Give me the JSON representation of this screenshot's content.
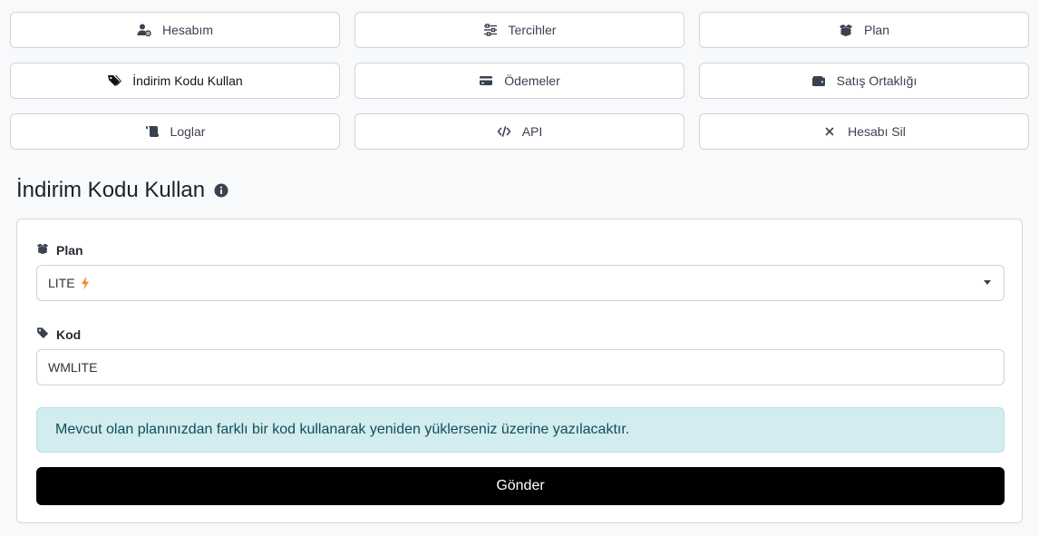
{
  "nav": {
    "items": [
      {
        "label": "Hesabım",
        "icon": "user-gear-icon"
      },
      {
        "label": "Tercihler",
        "icon": "sliders-icon"
      },
      {
        "label": "Plan",
        "icon": "box-open-icon"
      },
      {
        "label": "İndirim Kodu Kullan",
        "icon": "tags-icon"
      },
      {
        "label": "Ödemeler",
        "icon": "credit-card-icon"
      },
      {
        "label": "Satış Ortaklığı",
        "icon": "wallet-icon"
      },
      {
        "label": "Loglar",
        "icon": "scroll-icon"
      },
      {
        "label": "API",
        "icon": "code-icon"
      },
      {
        "label": "Hesabı Sil",
        "icon": "close-icon"
      }
    ]
  },
  "page": {
    "title": "İndirim Kodu Kullan"
  },
  "form": {
    "plan_label": "Plan",
    "plan_value": "LITE",
    "code_label": "Kod",
    "code_value": "WMLITE",
    "alert_text": "Mevcut olan planınızdan farklı bir kod kullanarak yeniden yüklerseniz üzerine yazılacaktır.",
    "submit_label": "Gönder"
  },
  "colors": {
    "accent_bolt": "#f08a24",
    "alert_bg": "#d2ecef",
    "alert_text": "#0f4f59",
    "submit_bg": "#000000"
  }
}
